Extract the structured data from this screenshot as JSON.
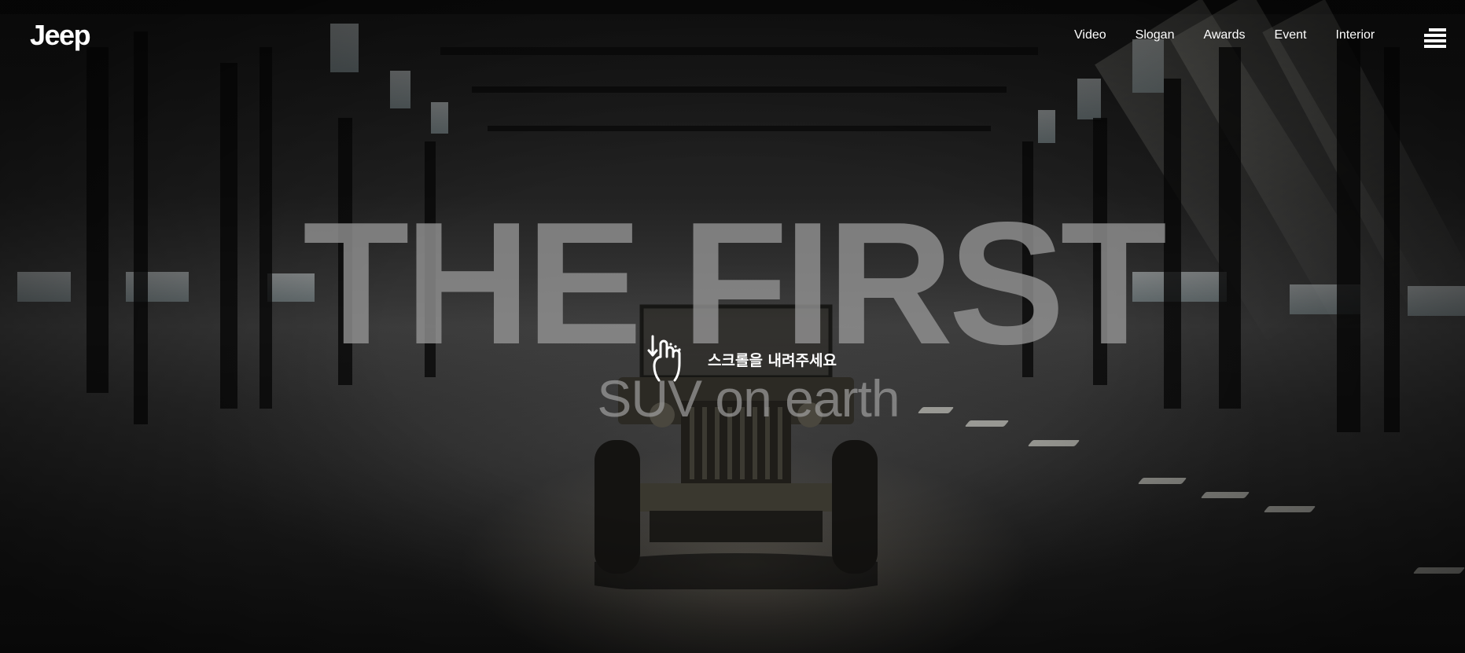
{
  "brand": {
    "logo_text": "Jeep"
  },
  "nav": {
    "items": [
      {
        "label": "Video",
        "active": true
      },
      {
        "label": "Slogan",
        "active": false
      },
      {
        "label": "Awards",
        "active": false
      },
      {
        "label": "Event",
        "active": false
      },
      {
        "label": "Interior",
        "active": false
      }
    ],
    "menu_icon": "hamburger-menu-icon",
    "active_color": "#f2d256"
  },
  "hero": {
    "headline": "THE FIRST",
    "subline": "SUV on earth",
    "scroll_hint": "스크롤을 내려주세요",
    "scroll_icon": "scroll-hand-icon"
  }
}
